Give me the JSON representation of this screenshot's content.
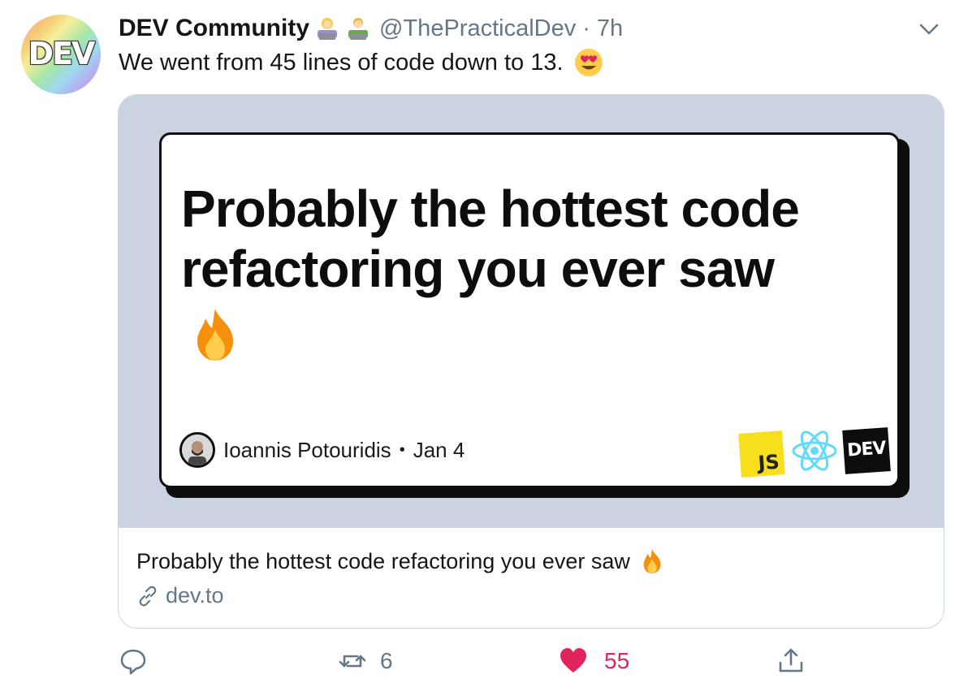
{
  "account": {
    "avatar_text": "DEV",
    "display_name": "DEV Community",
    "badges": [
      "woman-technologist-emoji",
      "man-technologist-emoji"
    ],
    "handle": "@ThePracticalDev",
    "separator": "·",
    "time": "7h"
  },
  "tweet": {
    "text": "We went from 45 lines of code down to 13.",
    "emoji": "heart-eyes-emoji"
  },
  "card": {
    "poster_title": "Probably the hottest code refactoring you ever saw",
    "poster_emoji": "fire-emoji",
    "author_name": "Ioannis Potouridis",
    "author_separator": "•",
    "author_date": "Jan 4",
    "logos": {
      "js": "JS",
      "react": "react-logo",
      "dev": "DEV"
    },
    "title": "Probably the hottest code refactoring you ever saw",
    "title_emoji": "fire-emoji",
    "domain": "dev.to"
  },
  "actions": {
    "reply_count": "",
    "retweet_count": "6",
    "like_count": "55",
    "liked": true,
    "share": ""
  },
  "colors": {
    "text_primary": "#14171a",
    "text_secondary": "#657786",
    "like": "#e0245e",
    "card_border": "#ccd6dd",
    "card_image_bg": "#cbd3e3"
  }
}
